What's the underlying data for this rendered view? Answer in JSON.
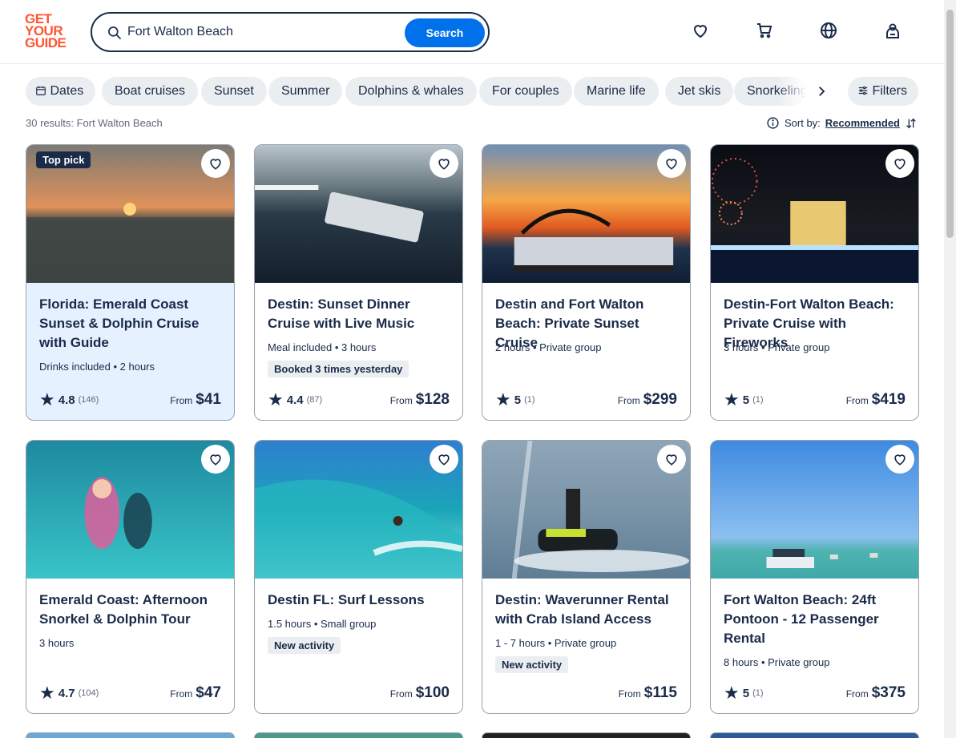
{
  "header": {
    "logo_lines": [
      "GET",
      "YOUR",
      "GUIDE"
    ],
    "search_value": "Fort Walton Beach",
    "search_button": "Search",
    "icons": [
      "heart-icon",
      "cart-icon",
      "globe-icon",
      "profile-icon"
    ]
  },
  "chips": [
    "Dates",
    "Boat cruises",
    "Sunset",
    "Summer",
    "Dolphins & whales",
    "For couples",
    "Marine life",
    "Jet skis",
    "Snorkeling"
  ],
  "filters_label": "Filters",
  "results_text": "30 results: Fort Walton Beach",
  "sort": {
    "label": "Sort by:",
    "value": "Recommended"
  },
  "cards": [
    {
      "badge": "Top pick",
      "title": "Florida: Emerald Coast Sunset & Dolphin Cruise with Guide",
      "meta": "Drinks included • 2 hours",
      "tag": "",
      "rating": "4.8",
      "count": "(146)",
      "from": "From",
      "price": "$41"
    },
    {
      "badge": "",
      "title": "Destin: Sunset Dinner Cruise with Live Music",
      "meta": "Meal included • 3 hours",
      "tag": "Booked 3 times yesterday",
      "rating": "4.4",
      "count": "(87)",
      "from": "From",
      "price": "$128"
    },
    {
      "badge": "",
      "title": "Destin and Fort Walton Beach: Private Sunset Cruise",
      "meta": "2 hours • Private group",
      "tag": "",
      "rating": "5",
      "count": "(1)",
      "from": "From",
      "price": "$299"
    },
    {
      "badge": "",
      "title": "Destin-Fort Walton Beach: Private Cruise with Fireworks",
      "meta": "3 hours • Private group",
      "tag": "",
      "rating": "5",
      "count": "(1)",
      "from": "From",
      "price": "$419"
    },
    {
      "badge": "",
      "title": "Emerald Coast: Afternoon Snorkel & Dolphin Tour",
      "meta": "3 hours",
      "tag": "",
      "rating": "4.7",
      "count": "(104)",
      "from": "From",
      "price": "$47"
    },
    {
      "badge": "",
      "title": "Destin FL: Surf Lessons",
      "meta": "1.5 hours • Small group",
      "tag": "New activity",
      "rating": "",
      "count": "",
      "from": "From",
      "price": "$100"
    },
    {
      "badge": "",
      "title": "Destin: Waverunner Rental with Crab Island Access",
      "meta": "1 - 7 hours • Private group",
      "tag": "New activity",
      "rating": "",
      "count": "",
      "from": "From",
      "price": "$115"
    },
    {
      "badge": "",
      "title": "Fort Walton Beach: 24ft Pontoon - 12 Passenger Rental",
      "meta": "8 hours • Private group",
      "tag": "",
      "rating": "5",
      "count": "(1)",
      "from": "From",
      "price": "$375"
    }
  ],
  "colors": {
    "brand": "#ff5533",
    "primary": "#0071eb",
    "ink": "#1a2b49",
    "highlight": "#e5f1ff"
  }
}
